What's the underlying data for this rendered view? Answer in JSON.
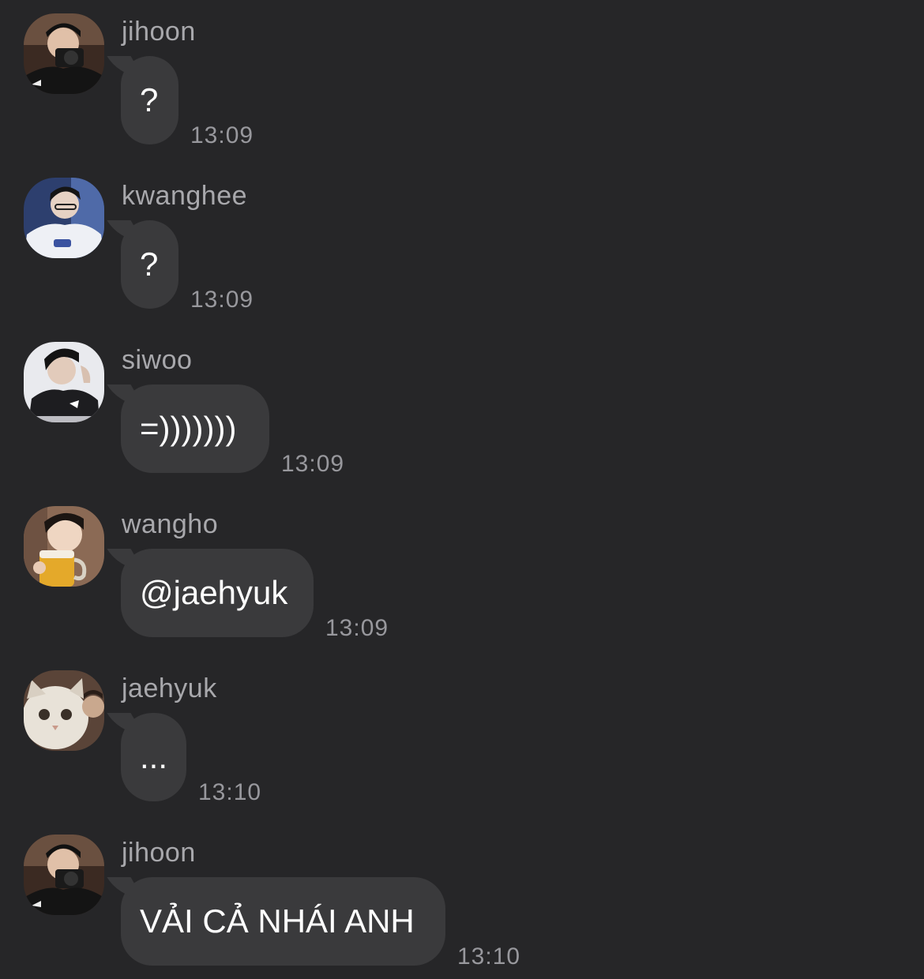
{
  "messages": [
    {
      "sender": "jihoon",
      "text": "?",
      "time": "13:09",
      "avatar": "jihoon-avatar"
    },
    {
      "sender": "kwanghee",
      "text": "?",
      "time": "13:09",
      "avatar": "kwanghee-avatar"
    },
    {
      "sender": "siwoo",
      "text": "=)))))))",
      "time": "13:09",
      "avatar": "siwoo-avatar"
    },
    {
      "sender": "wangho",
      "text": "@jaehyuk",
      "time": "13:09",
      "avatar": "wangho-avatar"
    },
    {
      "sender": "jaehyuk",
      "text": "...",
      "time": "13:10",
      "avatar": "jaehyuk-avatar"
    },
    {
      "sender": "jihoon",
      "text": "VẢI CẢ NHÁI ANH",
      "time": "13:10",
      "avatar": "jihoon-avatar"
    }
  ],
  "colors": {
    "background": "#262628",
    "bubble": "#3a3a3c",
    "sender_text": "#a8a8ac",
    "time_text": "#98989d",
    "message_text": "#ffffff"
  }
}
